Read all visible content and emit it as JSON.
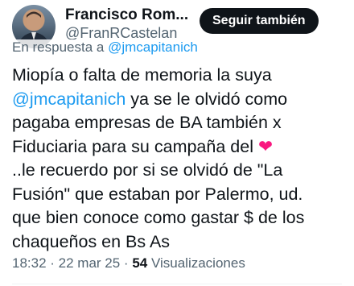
{
  "author": {
    "name": "Francisco Rom...",
    "handle": "@FranRCastelan"
  },
  "follow_button": "Seguir también",
  "reply_prefix": "En respuesta a ",
  "reply_mention": "@jmcapitanich",
  "tweet": {
    "line1": "Miopía o falta de memoria la suya",
    "mention": "@jmcapitanich",
    "line2_rest": " ya se le olvidó como",
    "line3": "pagaba empresas de BA también x",
    "line4_pre": "Fiduciaria para su campaña del ",
    "heart": "❤",
    "line5": "..le recuerdo por si se olvidó de \"La",
    "line6": "Fusión\" que estaban por Palermo, ud.",
    "line7": "que bien conoce como gastar $ de los",
    "line8": "chaqueños en Bs As"
  },
  "meta": {
    "time": "18:32",
    "sep1": " · ",
    "date": "22 mar 25",
    "sep2": " · ",
    "views_count": "54",
    "views_label": " Visualizaciones"
  },
  "icons": {
    "avatar": "profile-photo",
    "heart": "red-heart-emoji"
  },
  "colors": {
    "link": "#1d9bf0",
    "button_bg": "#0f1419",
    "secondary_text": "#536471",
    "heart": "#f91880"
  }
}
